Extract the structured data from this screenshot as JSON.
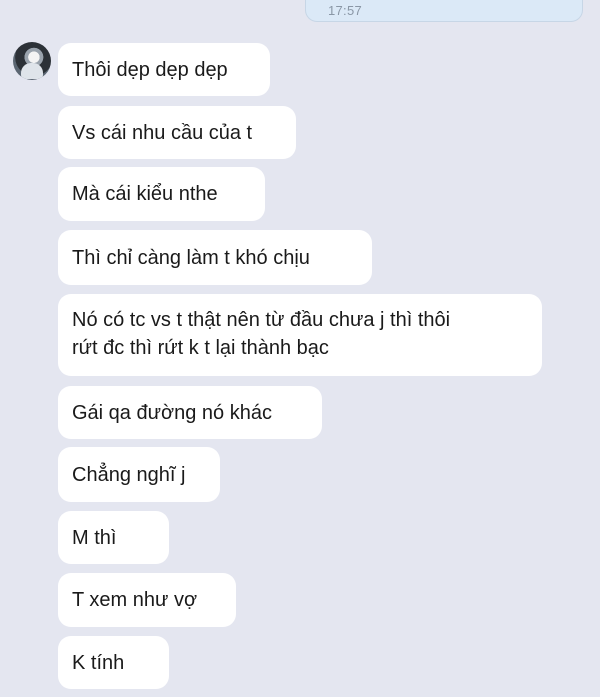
{
  "chat": {
    "sent_time": "17:57",
    "messages": [
      {
        "text": "Thôi dẹp dẹp dẹp"
      },
      {
        "text": "Vs cái nhu cầu của t"
      },
      {
        "text": "Mà cái kiểu nthe"
      },
      {
        "text": "Thì chỉ càng làm t khó chịu"
      },
      {
        "line1": "Nó có tc vs t thật nên từ đầu chưa j thì thôi",
        "line2": "rứt đc thì rứt k t lại thành bạc"
      },
      {
        "text": "Gái qa đường nó khác"
      },
      {
        "text": "Chẳng nghĩ j"
      },
      {
        "text": "M thì"
      },
      {
        "text": "T xem như vợ"
      },
      {
        "text": "K tính"
      }
    ]
  },
  "colors": {
    "background": "#e4e6f0",
    "received_bubble": "#ffffff",
    "sent_bubble": "#dbe9f7",
    "text": "#1a1a1a",
    "time": "#8a97a6"
  }
}
